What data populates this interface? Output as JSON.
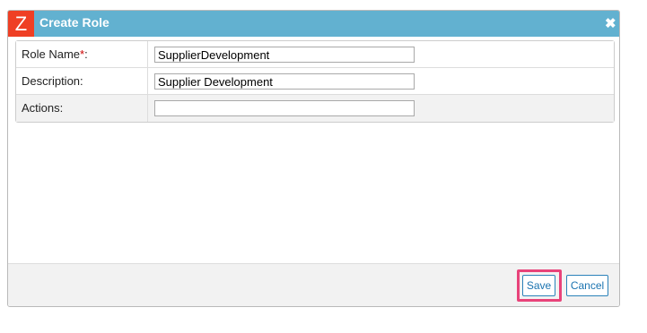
{
  "dialog": {
    "title": "Create Role",
    "logo_letter": "Z",
    "close_symbol": "✖",
    "fields": [
      {
        "label": "Role Name",
        "required_mark": "*",
        "suffix": ":",
        "value": ""
      },
      {
        "label": "Description:",
        "value": "Supplier Development"
      },
      {
        "label": "Actions:",
        "value": ""
      }
    ],
    "role_name_value": "SupplierDevelopment",
    "buttons": {
      "save": "Save",
      "cancel": "Cancel"
    }
  },
  "colors": {
    "titlebar": "#62b1d0",
    "logo": "#ef3f24",
    "highlight": "#e8437a",
    "button_text": "#1a73b0"
  }
}
